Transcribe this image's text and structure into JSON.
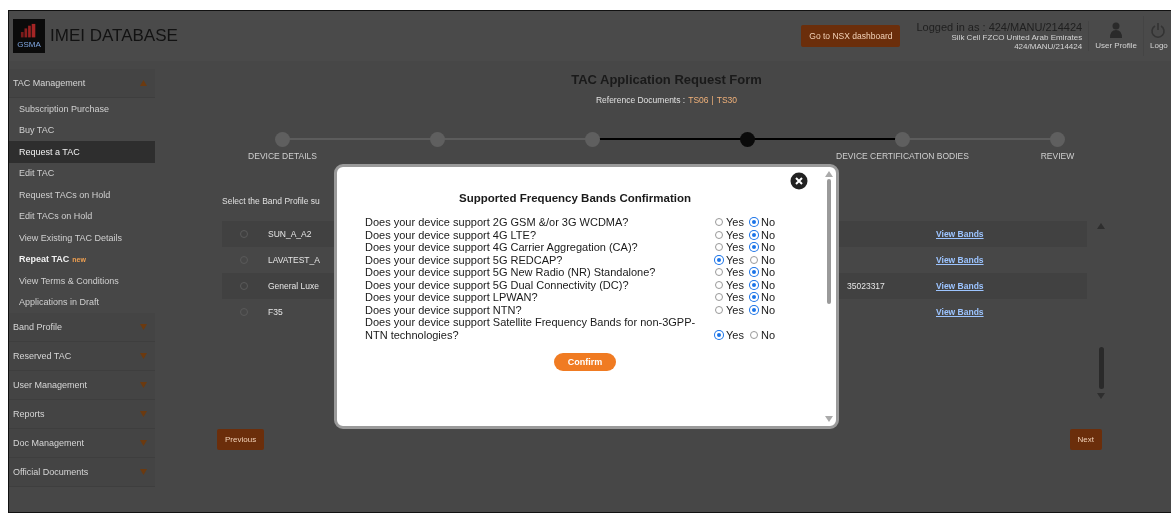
{
  "header": {
    "logo_text": "GSMA",
    "title": "IMEI DATABASE",
    "dashboard_button": "Go to NSX dashboard",
    "logged_in": "Logged in as : 424/MANU/214424",
    "company": "Silk Cell FZCO United Arab Emirates",
    "user_id": "424/MANU/214424",
    "user_profile": "User Profile",
    "logout": "Logo"
  },
  "sidebar": [
    {
      "label": "TAC Management",
      "expanded": true,
      "children": [
        {
          "label": "Subscription Purchase",
          "selected": false
        },
        {
          "label": "Buy TAC",
          "selected": false
        },
        {
          "label": "Request a TAC",
          "selected": true
        },
        {
          "label": "Edit TAC",
          "selected": false
        },
        {
          "label": "Request TACs on Hold",
          "selected": false
        },
        {
          "label": "Edit TACs on Hold",
          "selected": false
        },
        {
          "label": "View Existing TAC Details",
          "selected": false
        },
        {
          "label": "Repeat TAC",
          "selected": false,
          "badge": "new"
        },
        {
          "label": "View Terms & Conditions",
          "selected": false
        },
        {
          "label": "Applications in Draft",
          "selected": false
        }
      ]
    },
    {
      "label": "Band Profile",
      "expanded": false
    },
    {
      "label": "Reserved TAC",
      "expanded": false
    },
    {
      "label": "User Management",
      "expanded": false
    },
    {
      "label": "Reports",
      "expanded": false
    },
    {
      "label": "Doc Management",
      "expanded": false
    },
    {
      "label": "Official Documents",
      "expanded": false
    }
  ],
  "form": {
    "title": "TAC Application Request Form",
    "reference_label": "Reference Documents :",
    "reference_links": [
      "TS06",
      "TS30"
    ],
    "reference_separator": "|",
    "steps": [
      {
        "label": "DEVICE DETAILS",
        "selected": false
      },
      {
        "selected": false
      },
      {
        "selected": false
      },
      {
        "selected": true
      },
      {
        "label": "DEVICE CERTIFICATION BODIES",
        "selected": false
      },
      {
        "label": "REVIEW",
        "selected": false
      }
    ],
    "instruction": "Select the Band Profile su",
    "rows": [
      {
        "selected": false,
        "name": "SUN_A_A2",
        "link": "View Bands"
      },
      {
        "selected": false,
        "name": "LAVATEST_A",
        "link": "View Bands"
      },
      {
        "selected": false,
        "name": "General Luxe",
        "column_3": "35023317",
        "link": "View Bands"
      },
      {
        "selected": false,
        "name": "F35",
        "link": "View Bands"
      }
    ],
    "previous": "Previous",
    "next": "Next"
  },
  "modal": {
    "title": "Supported Frequency Bands Confirmation",
    "questions": [
      {
        "text": "Does your device support 2G GSM &/or 3G WCDMA?",
        "options": [
          {
            "label": "Yes",
            "selected": false
          },
          {
            "label": "No",
            "selected": true
          }
        ]
      },
      {
        "text": "Does your device support 4G LTE?",
        "options": [
          {
            "label": "Yes",
            "selected": false
          },
          {
            "label": "No",
            "selected": true
          }
        ]
      },
      {
        "text": "Does your device support 4G Carrier Aggregation (CA)?",
        "options": [
          {
            "label": "Yes",
            "selected": false
          },
          {
            "label": "No",
            "selected": true
          }
        ]
      },
      {
        "text": "Does your device support 5G REDCAP?",
        "options": [
          {
            "label": "Yes",
            "selected": true
          },
          {
            "label": "No",
            "selected": false
          }
        ]
      },
      {
        "text": "Does your device support 5G New Radio (NR) Standalone?",
        "options": [
          {
            "label": "Yes",
            "selected": false
          },
          {
            "label": "No",
            "selected": true
          }
        ]
      },
      {
        "text": "Does your device support 5G Dual Connectivity (DC)?",
        "options": [
          {
            "label": "Yes",
            "selected": false
          },
          {
            "label": "No",
            "selected": true
          }
        ]
      },
      {
        "text": "Does your device support LPWAN?",
        "options": [
          {
            "label": "Yes",
            "selected": false
          },
          {
            "label": "No",
            "selected": true
          }
        ]
      },
      {
        "text": "Does your device support NTN?",
        "options": [
          {
            "label": "Yes",
            "selected": false
          },
          {
            "label": "No",
            "selected": true
          }
        ]
      },
      {
        "text": "Does your device support Satellite Frequency Bands for non-3GPP-NTN technologies?",
        "options": [
          {
            "label": "Yes",
            "selected": true
          },
          {
            "label": "No",
            "selected": false
          }
        ]
      }
    ],
    "confirm": "Confirm"
  }
}
